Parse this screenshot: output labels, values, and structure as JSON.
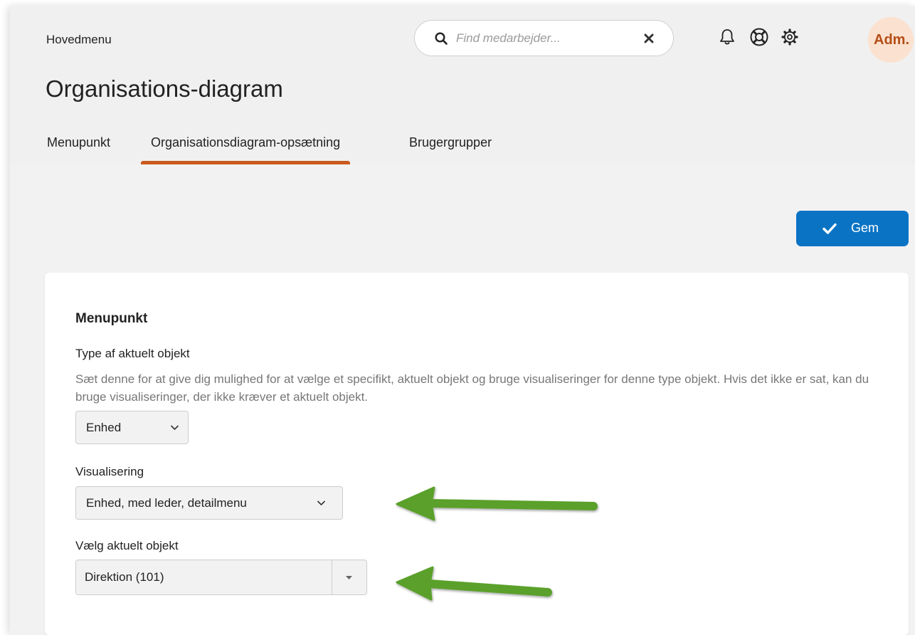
{
  "header": {
    "main_menu": "Hovedmenu",
    "search": {
      "placeholder": "Find medarbejder...",
      "value": ""
    },
    "avatar_text": "Adm.",
    "icons": [
      "search-icon",
      "clear-icon",
      "bell-icon",
      "help-icon",
      "gear-icon"
    ]
  },
  "page": {
    "title": "Organisations-diagram",
    "tabs": [
      {
        "label": "Menupunkt",
        "active": false
      },
      {
        "label": "Organisationsdiagram-opsætning",
        "active": true
      },
      {
        "label": "Brugergrupper",
        "active": false
      }
    ]
  },
  "toolbar": {
    "save_label": "Gem"
  },
  "form": {
    "section_title": "Menupunkt",
    "object_type": {
      "label": "Type af aktuelt objekt",
      "help": "Sæt denne for at give dig mulighed for at vælge et specifikt, aktuelt objekt og bruge visualiseringer for denne type objekt. Hvis det ikke er sat, kan du bruge visualiseringer, der ikke kræver et aktuelt objekt.",
      "value": "Enhed"
    },
    "visualization": {
      "label": "Visualisering",
      "value": "Enhed, med leder, detailmenu"
    },
    "current_object": {
      "label": "Vælg aktuelt objekt",
      "value": "Direktion (101)"
    }
  },
  "colors": {
    "accent_tab": "#c95a1d",
    "primary_button": "#0a73c4",
    "avatar_bg": "#fbe1cf",
    "avatar_text": "#b44e17",
    "annotation_arrow": "#5aa02c"
  }
}
